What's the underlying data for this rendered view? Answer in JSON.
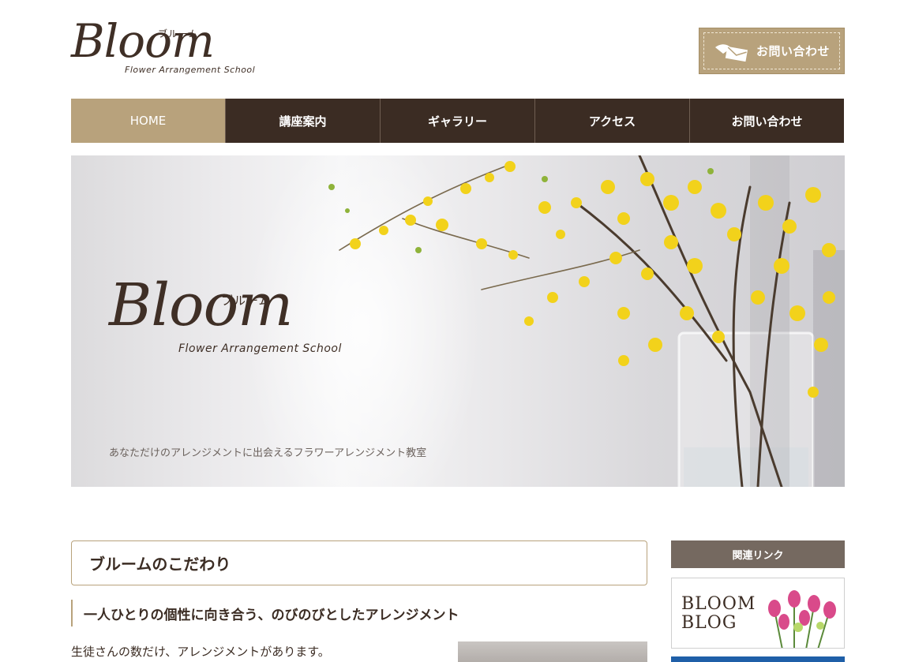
{
  "header": {
    "logo": {
      "script": "Bloom",
      "kana": "ブルーム",
      "sub": "Flower Arrangement School"
    },
    "contact_button": {
      "label": "お問い合わせ",
      "icon": "envelope-icon"
    }
  },
  "nav": {
    "items": [
      {
        "label": "HOME",
        "active": true
      },
      {
        "label": "講座案内",
        "active": false
      },
      {
        "label": "ギャラリー",
        "active": false
      },
      {
        "label": "アクセス",
        "active": false
      },
      {
        "label": "お問い合わせ",
        "active": false
      }
    ]
  },
  "hero": {
    "logo": {
      "script": "Bloom",
      "kana": "ブルーム",
      "sub": "Flower Arrangement School"
    },
    "tagline": "あなただけのアレンジメントに出会えるフラワーアレンジメント教室"
  },
  "main": {
    "section_title": "ブルームのこだわり",
    "sub_heading": "一人ひとりの個性に向き合う、のびのびとしたアレンジメント",
    "body_text": "生徒さんの数だけ、アレンジメントがあります。"
  },
  "sidebar": {
    "heading": "関連リンク",
    "blog_banner": {
      "line1": "BLOOM",
      "line2": "BLOG"
    }
  },
  "colors": {
    "accent": "#b8a27c",
    "nav_dark": "#3b2c23",
    "sidebar_head": "#756960",
    "text": "#3b2c23"
  }
}
